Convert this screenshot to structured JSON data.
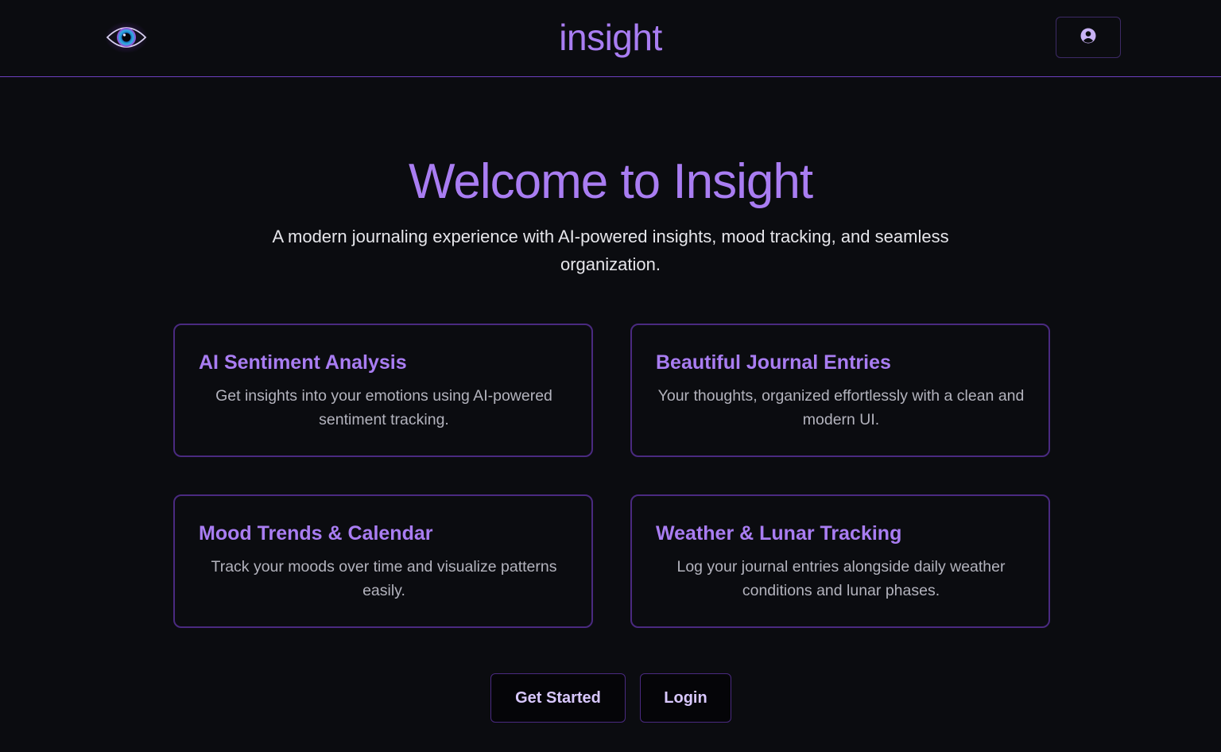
{
  "header": {
    "brand": "insight",
    "logo_icon": "eye-logo-icon",
    "profile_icon": "user-circle-icon"
  },
  "hero": {
    "title": "Welcome to Insight",
    "subtitle": "A modern journaling experience with AI-powered insights, mood tracking, and seamless organization."
  },
  "features": [
    {
      "title": "AI Sentiment Analysis",
      "description": "Get insights into your emotions using AI-powered sentiment tracking."
    },
    {
      "title": "Beautiful Journal Entries",
      "description": "Your thoughts, organized effortlessly with a clean and modern UI."
    },
    {
      "title": "Mood Trends & Calendar",
      "description": "Track your moods over time and visualize patterns easily."
    },
    {
      "title": "Weather & Lunar Tracking",
      "description": "Log your journal entries alongside daily weather conditions and lunar phases."
    }
  ],
  "actions": {
    "get_started": "Get Started",
    "login": "Login"
  },
  "colors": {
    "background": "#0b0c10",
    "accent": "#a97df2",
    "border": "#4a2a80"
  }
}
